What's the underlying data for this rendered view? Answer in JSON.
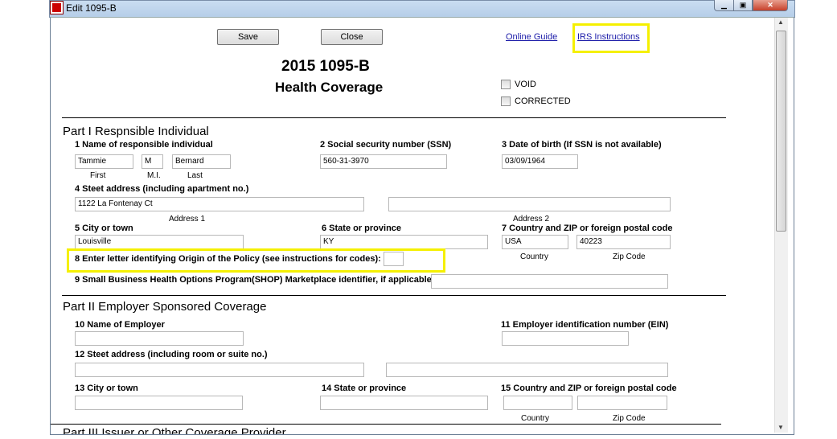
{
  "window": {
    "title": "Edit 1095-B"
  },
  "toolbar": {
    "save": "Save",
    "close": "Close",
    "online_guide": "Online Guide",
    "irs_instructions": "IRS Instructions"
  },
  "form": {
    "title": "2015 1095-B",
    "subtitle": "Health Coverage",
    "void": "VOID",
    "corrected": "CORRECTED"
  },
  "part1": {
    "heading": "Part I Respnsible Individual",
    "l1": "1 Name of responsible individual",
    "l2": "2 Social security number (SSN)",
    "l3": "3 Date of birth (If SSN is not available)",
    "first": "Tammie",
    "mi": "M",
    "last": "Bernard",
    "ssn": "560-31-3970",
    "dob": "03/09/1964",
    "first_lbl": "First",
    "mi_lbl": "M.I.",
    "last_lbl": "Last",
    "l4": "4 Steet address (including apartment no.)",
    "addr1": "1122 La Fontenay Ct",
    "addr2": "",
    "addr1_lbl": "Address 1",
    "addr2_lbl": "Address 2",
    "l5": "5 City or town",
    "l6": "6 State or province",
    "l7": "7 Country and ZIP or foreign postal code",
    "city": "Louisville",
    "state": "KY",
    "country": "USA",
    "zip": "40223",
    "country_lbl": "Country",
    "zip_lbl": "Zip Code",
    "l8": "8 Enter letter identifying Origin of the Policy (see instructions for codes):",
    "origin": "",
    "l9": "9 Small Business Health Options Program(SHOP) Marketplace identifier, if applicable.",
    "shop": ""
  },
  "part2": {
    "heading": "Part II Employer Sponsored Coverage",
    "l10": "10 Name of Employer",
    "l11": "11 Employer identification number (EIN)",
    "l12": "12 Steet address (including room or suite no.)",
    "l13": "13 City or town",
    "l14": "14 State or province",
    "l15": "15 Country and ZIP or foreign postal code",
    "country_lbl": "Country",
    "zip_lbl": "Zip Code"
  },
  "part3": {
    "heading": "Part III Issuer or Other Coverage Provider"
  }
}
